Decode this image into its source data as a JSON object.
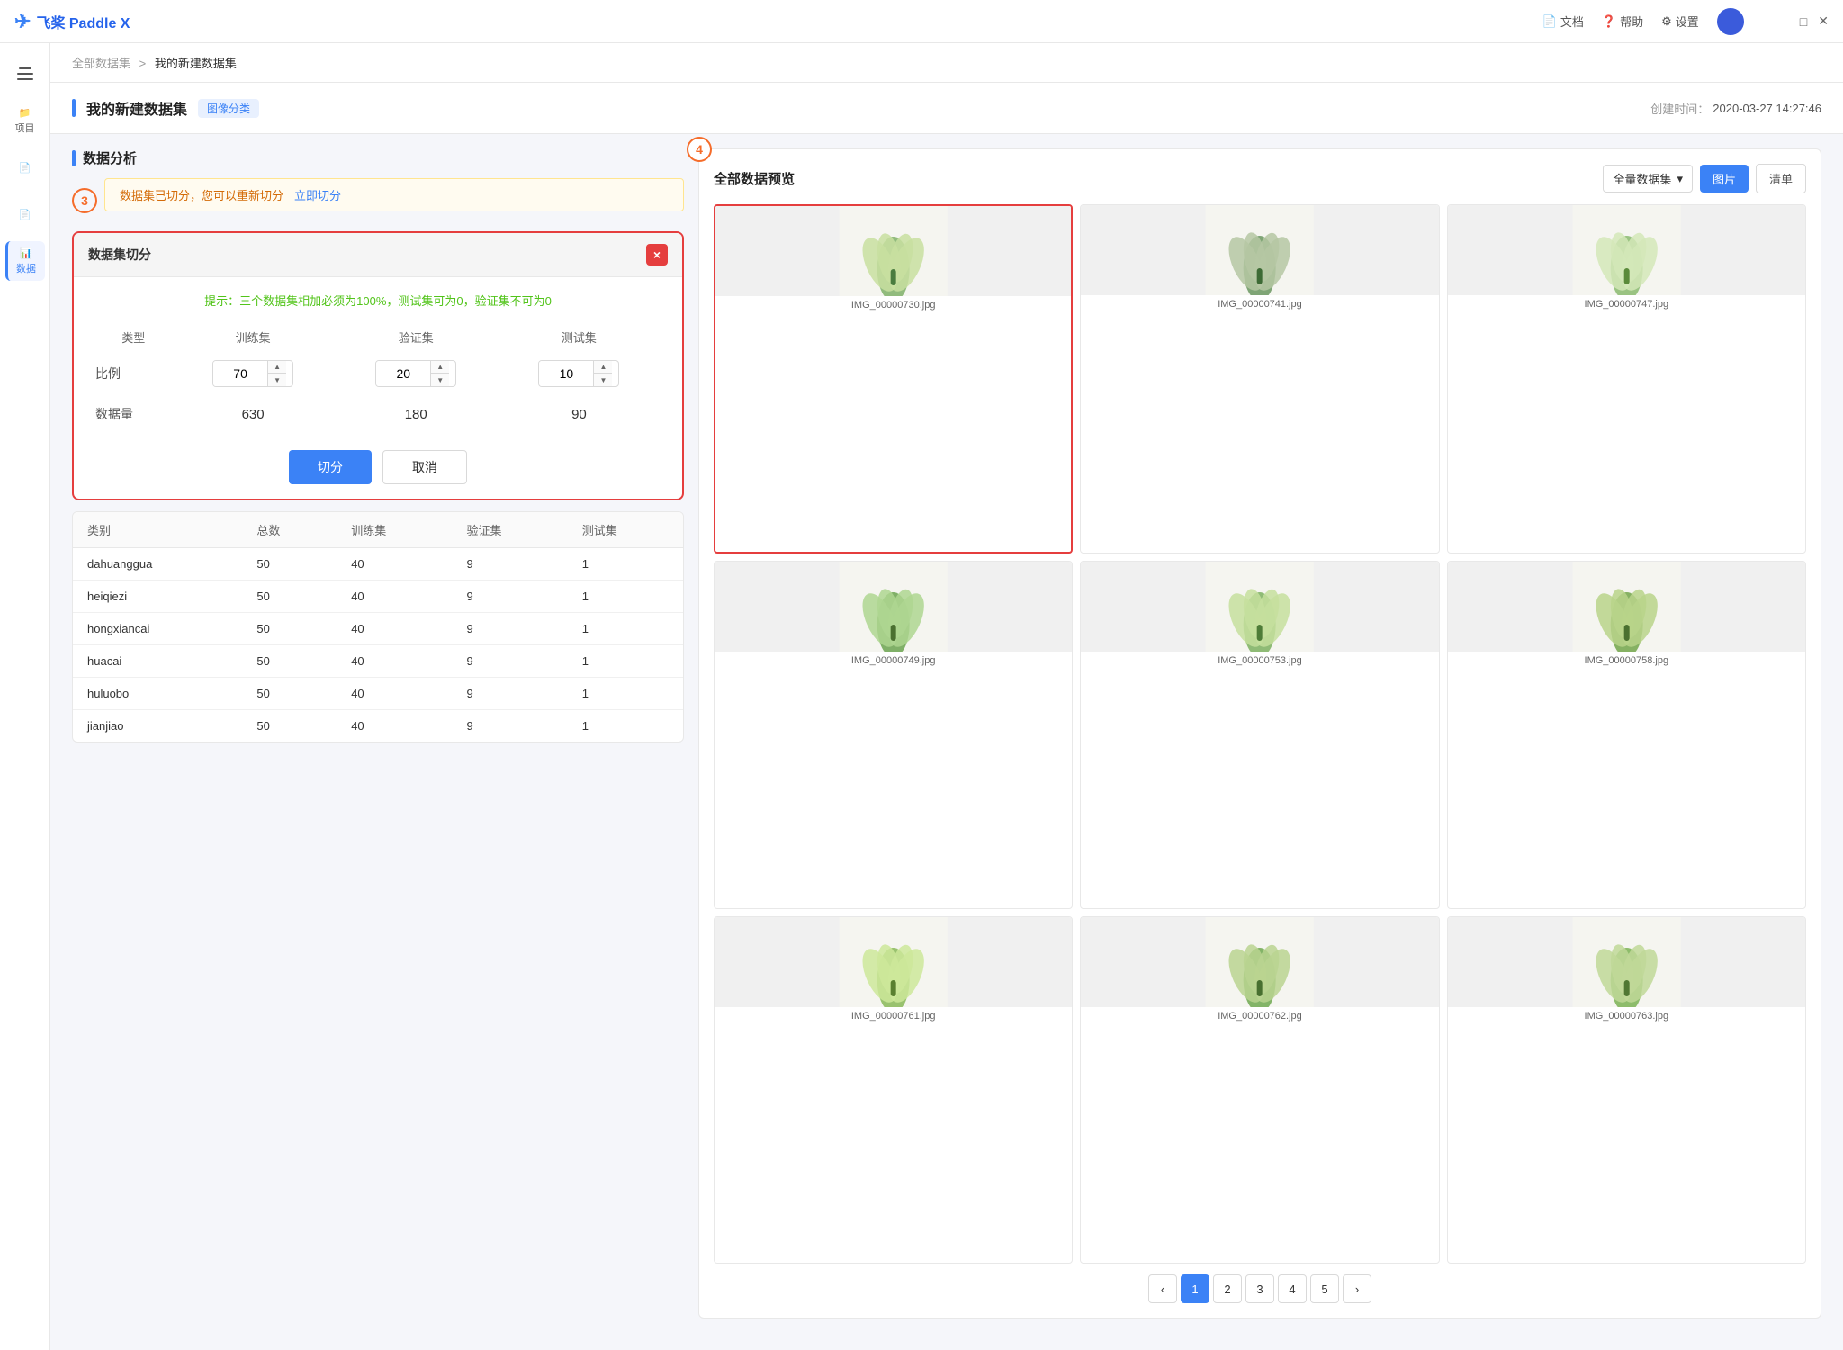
{
  "app": {
    "title": "飞桨 Paddle X",
    "logo_text": "飞桨 Paddle X"
  },
  "titlebar": {
    "doc_label": "文档",
    "help_label": "帮助",
    "settings_label": "设置"
  },
  "breadcrumb": {
    "all": "全部数据集",
    "separator": ">",
    "current": "我的新建数据集"
  },
  "page": {
    "title": "我的新建数据集",
    "tag": "图像分类",
    "create_label": "创建时间：",
    "create_time": "2020-03-27 14:27:46"
  },
  "sidebar": {
    "items": [
      {
        "label": "",
        "icon": "☰"
      },
      {
        "label": "项目",
        "icon": "📁"
      },
      {
        "label": "",
        "icon": "📄"
      },
      {
        "label": "",
        "icon": "📄"
      },
      {
        "label": "数据",
        "icon": "📊",
        "active": true
      }
    ]
  },
  "data_analysis": {
    "section_title": "数据分析",
    "alert_text": "数据集已切分，您可以重新切分",
    "alert_link": "立即切分",
    "step3_label": "3"
  },
  "modal": {
    "title": "数据集切分",
    "hint": "提示：三个数据集相加必须为100%，测试集可为0，验证集不可为0",
    "close_label": "×",
    "col_type": "类型",
    "col_train": "训练集",
    "col_val": "验证集",
    "col_test": "测试集",
    "row_ratio": "比例",
    "row_amount": "数据量",
    "train_ratio": "70",
    "val_ratio": "20",
    "test_ratio": "10",
    "train_amount": "630",
    "val_amount": "180",
    "test_amount": "90",
    "btn_split": "切分",
    "btn_cancel": "取消"
  },
  "table": {
    "columns": [
      "类别",
      "总数",
      "训练集",
      "验证集",
      "测试集"
    ],
    "rows": [
      {
        "name": "dahuanggua",
        "total": "50",
        "train": "40",
        "val": "9",
        "test": "1"
      },
      {
        "name": "heiqiezi",
        "total": "50",
        "train": "40",
        "val": "9",
        "test": "1"
      },
      {
        "name": "hongxiancai",
        "total": "50",
        "train": "40",
        "val": "9",
        "test": "1"
      },
      {
        "name": "huacai",
        "total": "50",
        "train": "40",
        "val": "9",
        "test": "1"
      },
      {
        "name": "huluobo",
        "total": "50",
        "train": "40",
        "val": "9",
        "test": "1"
      },
      {
        "name": "jianjiao",
        "total": "50",
        "train": "40",
        "val": "9",
        "test": "1"
      }
    ]
  },
  "preview": {
    "title": "全部数据预览",
    "step4_label": "4",
    "select_option": "全量数据集",
    "btn_image": "图片",
    "btn_list": "清单",
    "images": [
      {
        "name": "IMG_00000730.jpg",
        "selected": true
      },
      {
        "name": "IMG_00000741.jpg",
        "selected": false
      },
      {
        "name": "IMG_00000747.jpg",
        "selected": false
      },
      {
        "name": "IMG_00000749.jpg",
        "selected": false
      },
      {
        "name": "IMG_00000753.jpg",
        "selected": false
      },
      {
        "name": "IMG_00000758.jpg",
        "selected": false
      },
      {
        "name": "IMG_00000761.jpg",
        "selected": false
      },
      {
        "name": "IMG_00000762.jpg",
        "selected": false
      },
      {
        "name": "IMG_00000763.jpg",
        "selected": false
      }
    ],
    "pagination": {
      "current": 1,
      "pages": [
        "1",
        "2",
        "3",
        "4",
        "5"
      ]
    }
  }
}
